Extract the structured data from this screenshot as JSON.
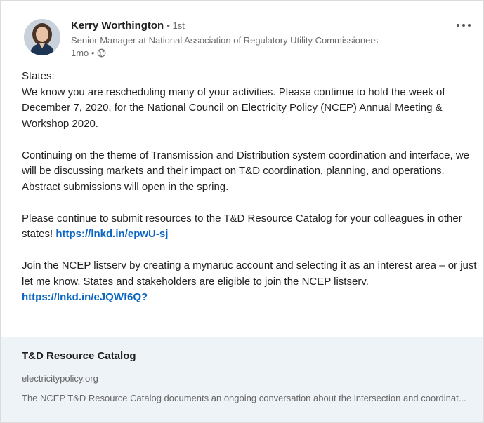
{
  "post": {
    "author": {
      "name": "Kerry Worthington",
      "degree": "• 1st",
      "headline": "Senior Manager at National Association of Regulatory Utility Commissioners"
    },
    "time_ago": "1mo •",
    "visibility_icon": "globe-icon",
    "more_icon": "ellipsis-icon",
    "paragraphs": [
      {
        "lines": [
          "States:",
          "We know you are rescheduling many of your activities. Please continue to hold the week of December 7, 2020, for the National Council on Electricity Policy (NCEP) Annual Meeting & Workshop 2020."
        ]
      },
      {
        "text": "Continuing on the theme of Transmission and Distribution system coordination and interface, we will be discussing markets and their impact on T&D coordination, planning, and operations. Abstract submissions will open in the spring."
      },
      {
        "text": "Please continue to submit resources to the T&D Resource Catalog for your colleagues in other states!",
        "link": "https://lnkd.in/epwU-sj"
      },
      {
        "text": "Join the NCEP listserv by creating a mynaruc account and selecting it as an interest area – or just let me know. States and stakeholders are eligible to join the NCEP listserv.",
        "link": "https://lnkd.in/eJQWf6Q?"
      }
    ],
    "preview": {
      "title": "T&D Resource Catalog",
      "domain": "electricitypolicy.org",
      "description": "The NCEP T&D Resource Catalog documents an ongoing conversation about the intersection and coordinat..."
    },
    "colors": {
      "link": "#0a66c2",
      "preview_bg": "#eef3f8",
      "muted_text": "#6b6b6b"
    }
  }
}
